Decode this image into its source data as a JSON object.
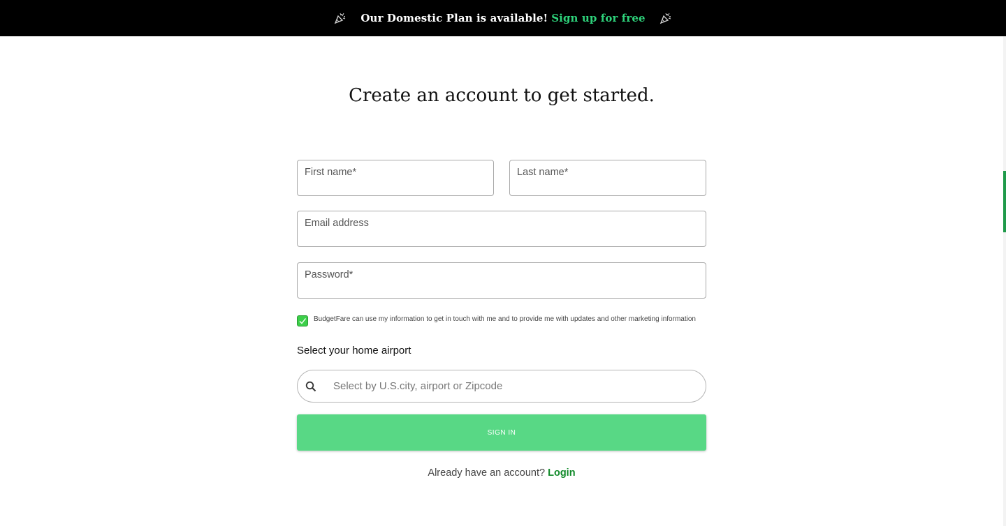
{
  "banner": {
    "message": "Our Domestic Plan is available!",
    "cta": "Sign up for free",
    "icon": "party-popper-icon"
  },
  "page": {
    "title": "Create an account to get started."
  },
  "form": {
    "first_name_label": "First name*",
    "last_name_label": "Last name*",
    "email_label": "Email address",
    "password_label": "Password*",
    "consent_text": "BudgetFare can use my information to get in touch with me and to provide me with updates and other marketing information",
    "consent_checked": true,
    "airport_label": "Select your home airport",
    "airport_placeholder": "Select by U.S.city, airport or Zipcode",
    "submit_label": "SIGN IN"
  },
  "footer": {
    "prompt": "Already have an account?",
    "login_label": "Login"
  },
  "colors": {
    "banner_bg": "#000000",
    "accent": "#2ed17a",
    "button": "#58d885",
    "link": "#118a2a",
    "checkbox": "#3ccf49"
  }
}
